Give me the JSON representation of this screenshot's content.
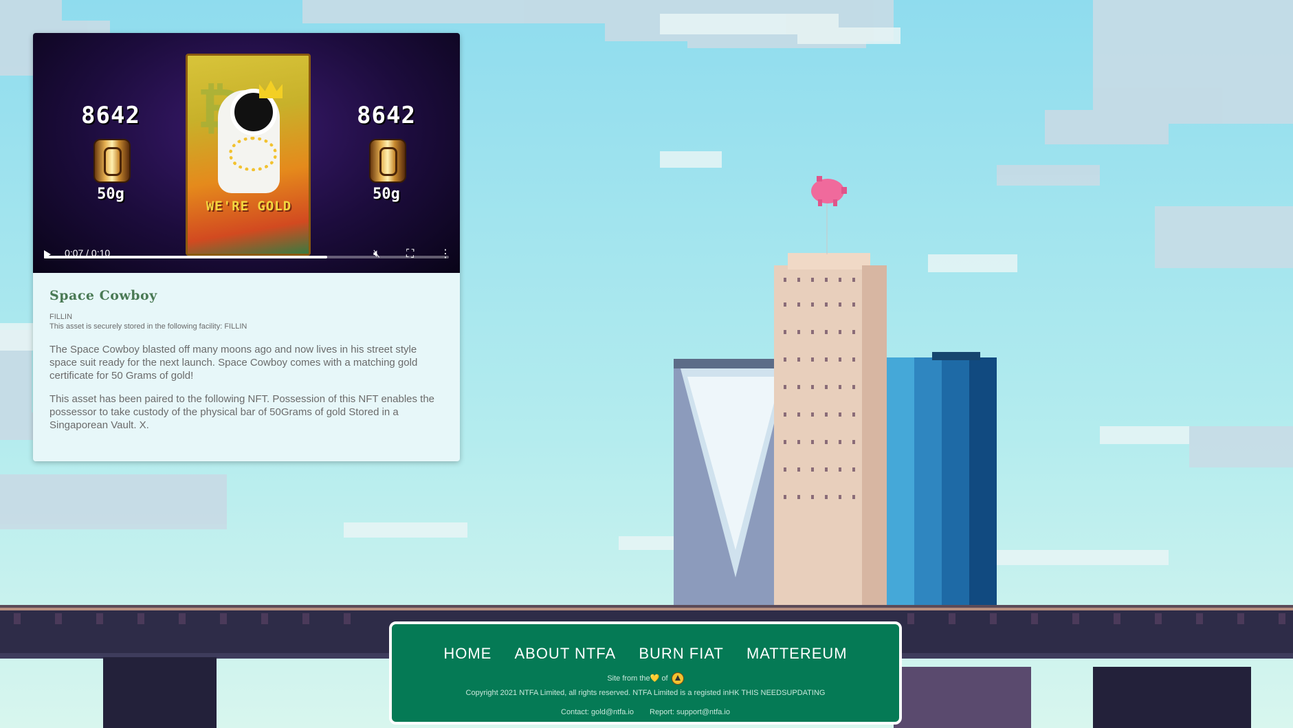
{
  "nft": {
    "counter_left": "8642",
    "counter_right": "8642",
    "weight_left": "50g",
    "weight_right": "50g",
    "art_caption": "WE'RE GOLD",
    "title": "Space Cowboy",
    "location": "FILLIN",
    "storage_note": "This asset is securely stored in the following facility: FILLIN",
    "description": "The Space Cowboy blasted off many moons ago and now lives in his street style space suit ready for the next launch. Space Cowboy comes with a matching gold certificate for 50 Grams of gold!",
    "pairing": "This asset has been paired to the following NFT. Possession of this NFT enables the possessor to take custody of the physical bar of 50Grams of gold Stored in a Singaporean Vault. X."
  },
  "video": {
    "time": "0:07 / 0:10",
    "progress": 0.7,
    "icons": [
      "play-icon",
      "mute-icon",
      "fullscreen-icon",
      "more-options-icon"
    ]
  },
  "footer": {
    "nav": [
      "HOME",
      "ABOUT NTFA",
      "BURN FIAT",
      "MATTEREUM"
    ],
    "made_prefix": "Site from the",
    "made_heart": "💛",
    "made_of": "of",
    "copyright": "Copyright 2021 NTFA Limited, all rights reserved. NTFA Limited is a registed inHK THIS NEEDSUPDATING",
    "contact": "Contact: gold@ntfa.io",
    "report": "Report: support@ntfa.io"
  },
  "colors": {
    "sky": "#8ee0ee",
    "footer_bg": "#057a55",
    "title_green": "#4a7a55"
  }
}
